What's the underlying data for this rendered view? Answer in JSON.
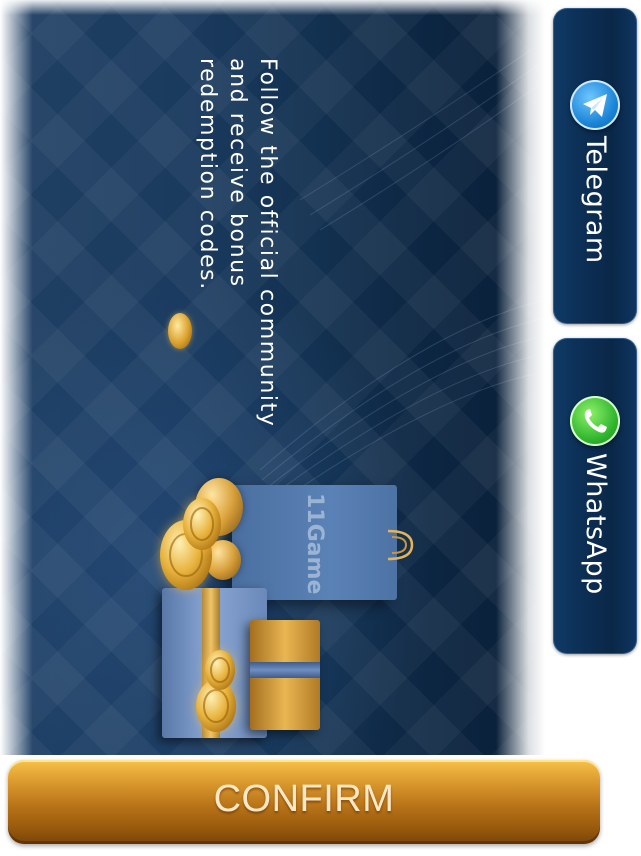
{
  "banner": {
    "promo_text": "Follow the official community and receive bonus redemption codes.",
    "bag_label": "11Game"
  },
  "social": {
    "telegram": {
      "label": "Telegram",
      "icon": "telegram-icon",
      "color": "#1a83d6"
    },
    "whatsapp": {
      "label": "WhatsApp",
      "icon": "whatsapp-icon",
      "color": "#2fb52d"
    }
  },
  "actions": {
    "confirm_label": "CONFIRM"
  },
  "colors": {
    "banner_bg": "#1a3a5e",
    "side_button_bg": "#0c2f55",
    "confirm_gold": "#e0a032"
  }
}
